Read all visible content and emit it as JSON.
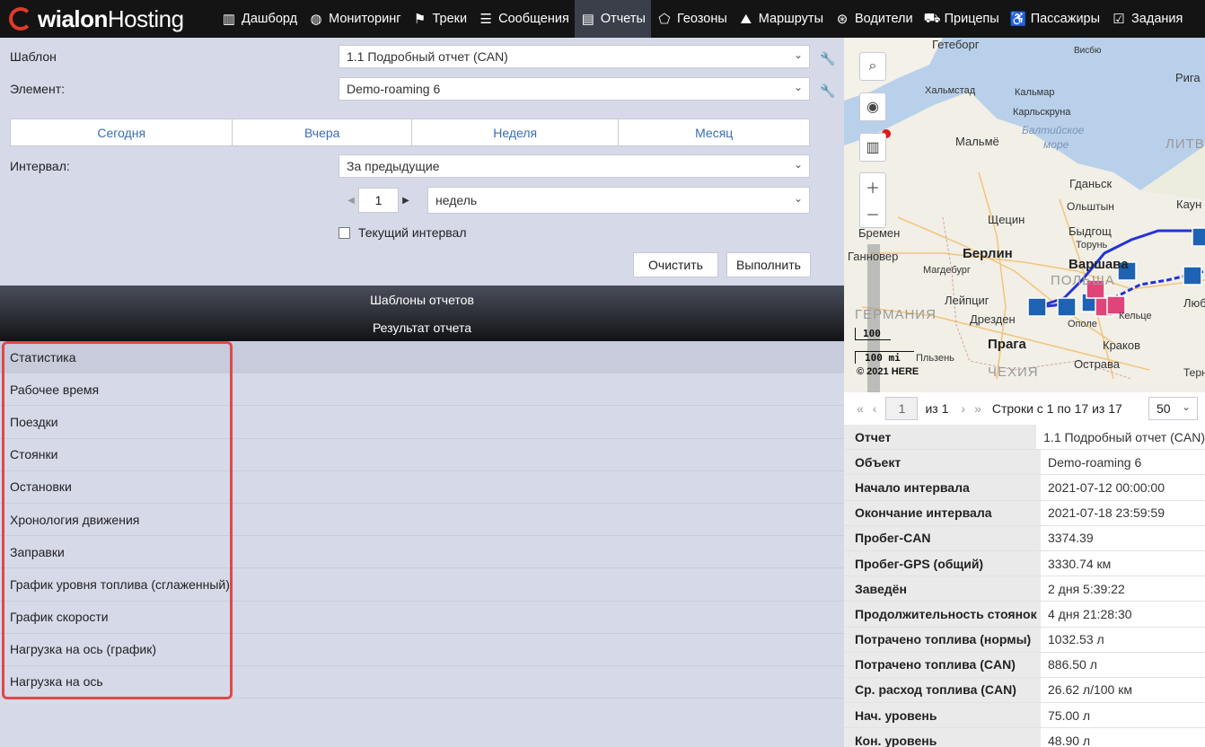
{
  "app": {
    "logo_main": "wialon",
    "logo_sub": "Hosting"
  },
  "nav": [
    {
      "icon": "bar-chart-icon",
      "glyph": "▥",
      "label": "Дашборд"
    },
    {
      "icon": "globe-icon",
      "glyph": "◍",
      "label": "Мониторинг"
    },
    {
      "icon": "checkered-flag-icon",
      "glyph": "⚑",
      "label": "Треки"
    },
    {
      "icon": "message-list-icon",
      "glyph": "☰",
      "label": "Сообщения"
    },
    {
      "icon": "report-icon",
      "glyph": "▤",
      "label": "Отчеты",
      "active": true
    },
    {
      "icon": "geofence-icon",
      "glyph": "⬠",
      "label": "Геозоны"
    },
    {
      "icon": "route-icon",
      "glyph": "⛰",
      "label": "Маршруты"
    },
    {
      "icon": "steering-wheel-icon",
      "glyph": "⊛",
      "label": "Водители"
    },
    {
      "icon": "trailer-icon",
      "glyph": "⛟",
      "label": "Прицепы"
    },
    {
      "icon": "passenger-icon",
      "glyph": "♿",
      "label": "Пассажиры"
    },
    {
      "icon": "task-icon",
      "glyph": "☑",
      "label": "Задания"
    }
  ],
  "form": {
    "template_label": "Шаблон",
    "template_value": "1.1 Подробный отчет (CAN)",
    "element_label": "Элемент:",
    "element_value": "Demo-roaming 6",
    "quick": [
      "Сегодня",
      "Вчера",
      "Неделя",
      "Месяц"
    ],
    "interval_label": "Интервал:",
    "interval_value": "За предыдущие",
    "interval_count": "1",
    "interval_unit": "недель",
    "current_interval_label": "Текущий интервал",
    "clear_button": "Очистить",
    "run_button": "Выполнить"
  },
  "sections": {
    "templates": "Шаблоны отчетов",
    "result": "Результат отчета"
  },
  "results": [
    "Статистика",
    "Рабочее время",
    "Поездки",
    "Стоянки",
    "Остановки",
    "Хронология движения",
    "Заправки",
    "График уровня топлива (сглаженный)",
    "График скорости",
    "Нагрузка на ось (график)",
    "Нагрузка на ось"
  ],
  "map": {
    "labels": [
      "Гетеборг",
      "Висбю",
      "Рига",
      "Хальмстад",
      "Кальмар",
      "Карльскруна",
      "Мальмё",
      "Балтийское",
      "море",
      "ЛИТВ",
      "Гданьск",
      "Каун",
      "Ольштын",
      "Щецин",
      "Бремен",
      "Быдгощ",
      "Торунь",
      "Ганновер",
      "Берлин",
      "Варшава",
      "Магдебург",
      "ПОЛЬША",
      "Лейпциг",
      "Люб",
      "ГЕРМАНИЯ",
      "Дрезден",
      "Кельце",
      "Ополе",
      "Прага",
      "Краков",
      "Пльзень",
      "Острава",
      "ЧЕХИЯ",
      "Терн"
    ],
    "scale_km": "100",
    "scale_mi": "100 mi",
    "copyright": "© 2021 HERE"
  },
  "pager": {
    "page": "1",
    "of": "из 1",
    "rows": "Строки с 1 по 17 из 17",
    "per_page": "50"
  },
  "stats": [
    {
      "k": "Отчет",
      "v": "1.1 Подробный отчет (CAN)"
    },
    {
      "k": "Объект",
      "v": "Demo-roaming 6"
    },
    {
      "k": "Начало интервала",
      "v": "2021-07-12 00:00:00"
    },
    {
      "k": "Окончание интервала",
      "v": "2021-07-18 23:59:59"
    },
    {
      "k": "Пробег-CAN",
      "v": "3374.39"
    },
    {
      "k": "Пробег-GPS (общий)",
      "v": "3330.74 км"
    },
    {
      "k": "Заведён",
      "v": "2 дня 5:39:22"
    },
    {
      "k": "Продолжительность стоянок",
      "v": "4 дня 21:28:30"
    },
    {
      "k": "Потрачено топлива (нормы)",
      "v": "1032.53 л"
    },
    {
      "k": "Потрачено топлива (CAN)",
      "v": "886.50 л"
    },
    {
      "k": "Ср. расход топлива (CAN)",
      "v": "26.62 л/100 км"
    },
    {
      "k": "Нач. уровень",
      "v": "75.00 л"
    },
    {
      "k": "Кон. уровень",
      "v": "48.90 л"
    }
  ]
}
